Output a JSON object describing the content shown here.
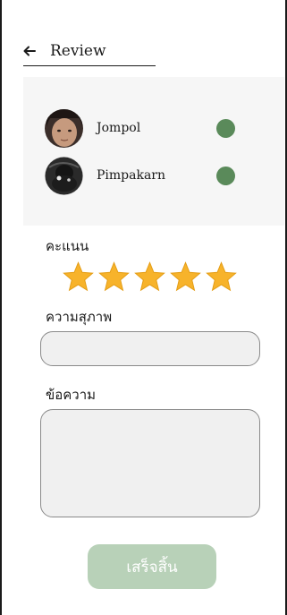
{
  "header": {
    "title": "Review"
  },
  "users": [
    {
      "name": "Jompol",
      "status_color": "#5a8a5a"
    },
    {
      "name": "Pimpakarn",
      "status_color": "#5a8a5a"
    }
  ],
  "rating": {
    "label": "คะแนน",
    "stars_filled": 5,
    "stars_total": 5,
    "star_color": "#f7b32b"
  },
  "politeness": {
    "label": "ความสุภาพ",
    "value": ""
  },
  "message": {
    "label": "ข้อความ",
    "value": ""
  },
  "finish_button": {
    "label": "เสร็จสิ้น",
    "color": "#b8d1b8"
  }
}
